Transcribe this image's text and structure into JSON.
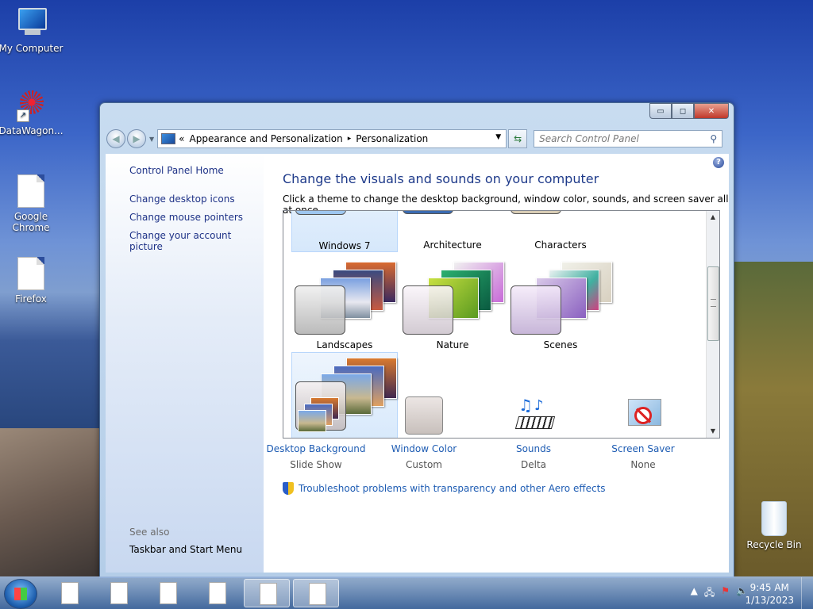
{
  "desktop": {
    "icons": [
      {
        "label": "My Computer"
      },
      {
        "label": "DataWagon..."
      },
      {
        "label": "Google Chrome"
      },
      {
        "label": "Firefox"
      },
      {
        "label": "Recycle Bin"
      }
    ]
  },
  "window": {
    "controls": {
      "minimize": "▭",
      "maximize": "◻",
      "close": "✕"
    },
    "breadcrumb": {
      "prefix": "«",
      "parent": "Appearance and Personalization",
      "separator": "▸",
      "current": "Personalization"
    },
    "search": {
      "placeholder": "Search Control Panel"
    },
    "sidebar": {
      "home": "Control Panel Home",
      "links": [
        "Change desktop icons",
        "Change mouse pointers",
        "Change your account picture"
      ],
      "see_also": "See also",
      "see_also_links": [
        "Taskbar and Start Menu"
      ]
    },
    "main": {
      "help": "?",
      "title": "Change the visuals and sounds on your computer",
      "subtitle": "Click a theme to change the desktop background, window color, sounds, and screen saver all at once.",
      "themes": [
        {
          "label": "Windows 7"
        },
        {
          "label": "Architecture"
        },
        {
          "label": "Characters"
        },
        {
          "label": "Landscapes"
        },
        {
          "label": "Nature"
        },
        {
          "label": "Scenes"
        },
        {
          "label": ""
        }
      ],
      "bottom": [
        {
          "name": "Desktop Background",
          "value": "Slide Show"
        },
        {
          "name": "Window Color",
          "value": "Custom"
        },
        {
          "name": "Sounds",
          "value": "Delta"
        },
        {
          "name": "Screen Saver",
          "value": "None"
        }
      ],
      "troubleshoot": "Troubleshoot problems with transparency and other Aero effects"
    }
  },
  "taskbar": {
    "clock": {
      "time": "9:45 AM",
      "date": "1/13/2023"
    },
    "tray_icons": [
      "show-hidden-icon",
      "network-icon",
      "action-center-icon",
      "volume-icon"
    ]
  },
  "colors": {
    "link": "#1e5cb3",
    "title": "#1e3a8a",
    "close_button": "#c0382a"
  }
}
